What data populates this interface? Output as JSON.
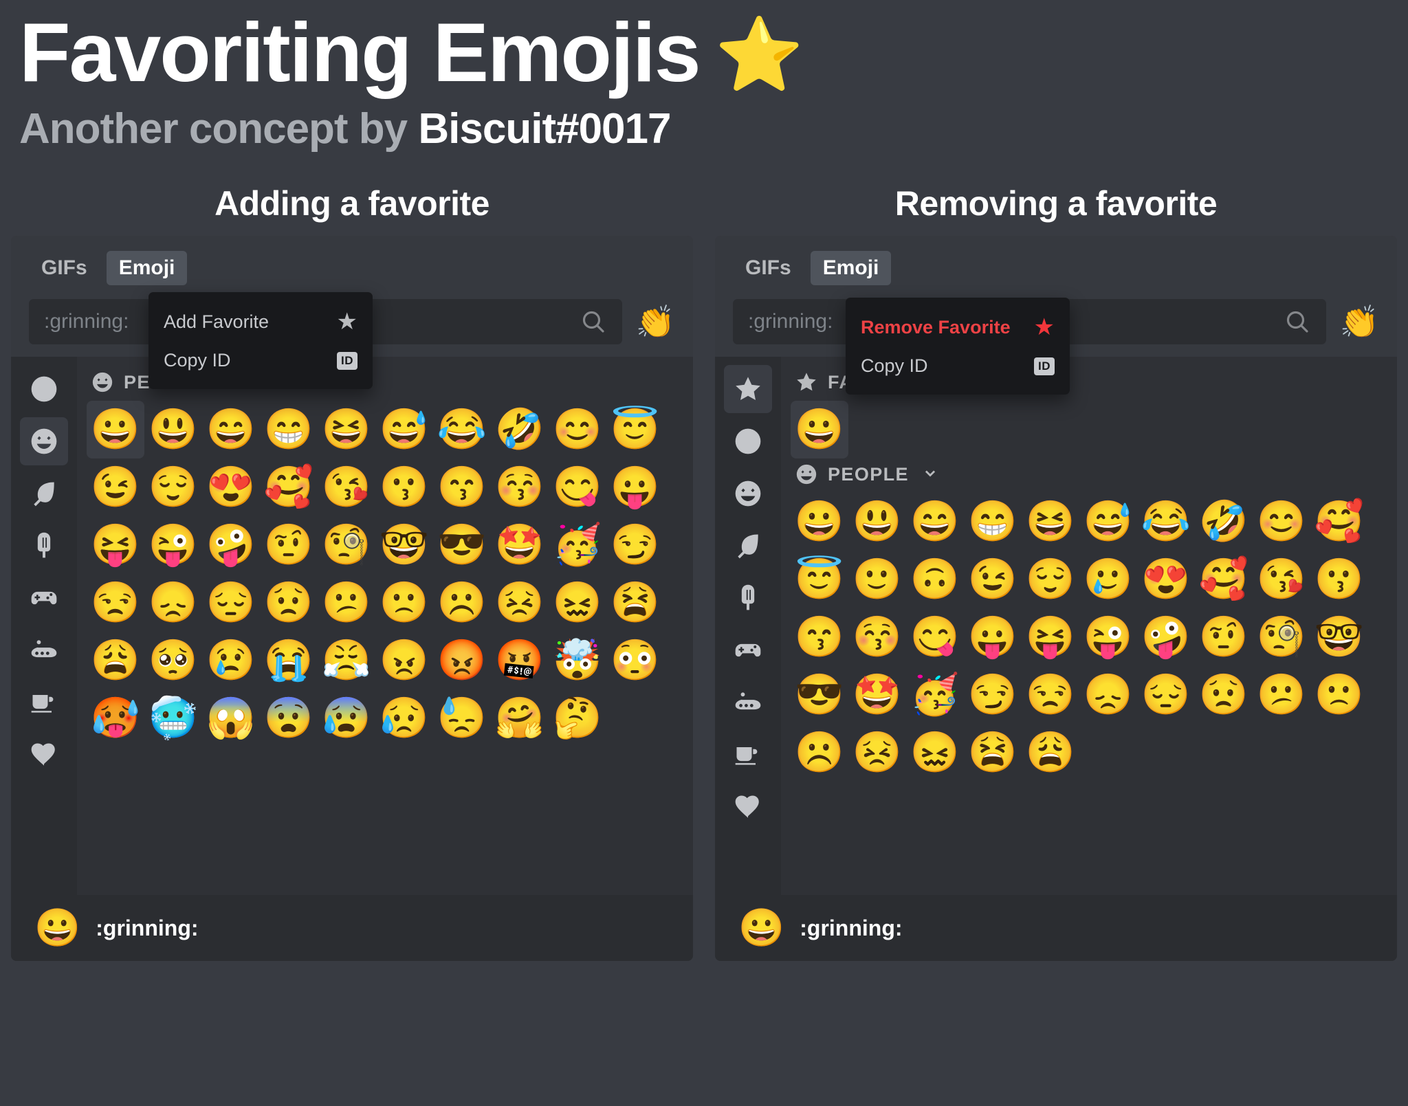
{
  "header": {
    "title": "Favoriting Emojis",
    "title_star": "⭐",
    "subtitle_prefix": "Another concept by ",
    "author": "Biscuit#0017"
  },
  "colors": {
    "page_bg": "#383b42",
    "panel_bg": "#36393f",
    "grid_bg": "#2f3136",
    "sidebar_bg": "#2b2d31",
    "menu_bg": "#18191c",
    "accent_star": "#f5a623",
    "danger": "#ed4245",
    "text_muted": "#b9bbbe",
    "text_white": "#ffffff"
  },
  "columns": [
    {
      "heading": "Adding a favorite",
      "tabs": [
        {
          "label": "GIFs",
          "active": false
        },
        {
          "label": "Emoji",
          "active": true
        }
      ],
      "search": {
        "value": ":grinning:",
        "placeholder": ":grinning:",
        "icon": "search-icon",
        "trailing_emoji": "👏"
      },
      "sidebar": [
        {
          "name": "recent",
          "icon": "clock-icon",
          "active": false
        },
        {
          "name": "people",
          "icon": "smiley-icon",
          "active": true
        },
        {
          "name": "nature",
          "icon": "leaf-icon",
          "active": false
        },
        {
          "name": "food",
          "icon": "popsicle-icon",
          "active": false
        },
        {
          "name": "activities",
          "icon": "gamepad-icon",
          "active": false
        },
        {
          "name": "travel",
          "icon": "vehicle-icon",
          "active": false
        },
        {
          "name": "objects",
          "icon": "mug-icon",
          "active": false
        },
        {
          "name": "symbols",
          "icon": "heart-icon",
          "active": false
        }
      ],
      "category": {
        "icon": "smiley-icon",
        "label": "PEOPLE",
        "chevron": "chevron-down-icon"
      },
      "emoji_rows": [
        [
          "😀",
          "😃",
          "😄",
          "😁",
          "😆",
          "😅",
          "😂",
          "🤣",
          "😊"
        ],
        [
          "😇",
          "😉",
          "😌",
          "😍",
          "🥰",
          "😘",
          "😗",
          "😙",
          "😚"
        ],
        [
          "😋",
          "😛",
          "😝",
          "😜",
          "🤪",
          "🤨",
          "🧐",
          "🤓",
          "😎"
        ],
        [
          "🤩",
          "🥳",
          "😏",
          "😒",
          "😞",
          "😔",
          "😟",
          "😕",
          "🙁"
        ],
        [
          "☹️",
          "😣",
          "😖",
          "😫",
          "😩",
          "🥺",
          "😢",
          "😭",
          "😤"
        ],
        [
          "😠",
          "😡",
          "🤬",
          "🤯",
          "😳",
          "🥵",
          "🥶",
          "😱",
          "😨"
        ],
        [
          "😰",
          "😥",
          "😓",
          "🤗",
          "🤔"
        ]
      ],
      "selected_emoji": "😀",
      "context_menu": {
        "items": [
          {
            "label": "Add Favorite",
            "icon": "star-icon",
            "danger": false
          },
          {
            "label": "Copy ID",
            "icon": "id-badge-icon",
            "danger": false
          }
        ]
      },
      "footer": {
        "emoji": "😀",
        "name": ":grinning:"
      }
    },
    {
      "heading": "Removing a favorite",
      "tabs": [
        {
          "label": "GIFs",
          "active": false
        },
        {
          "label": "Emoji",
          "active": true
        }
      ],
      "search": {
        "value": ":grinning:",
        "placeholder": ":grinning:",
        "icon": "search-icon",
        "trailing_emoji": "👏"
      },
      "sidebar": [
        {
          "name": "favorites",
          "icon": "star-icon",
          "active": true
        },
        {
          "name": "recent",
          "icon": "clock-icon",
          "active": false
        },
        {
          "name": "people",
          "icon": "smiley-icon",
          "active": false
        },
        {
          "name": "nature",
          "icon": "leaf-icon",
          "active": false
        },
        {
          "name": "food",
          "icon": "popsicle-icon",
          "active": false
        },
        {
          "name": "activities",
          "icon": "gamepad-icon",
          "active": false
        },
        {
          "name": "travel",
          "icon": "vehicle-icon",
          "active": false
        },
        {
          "name": "objects",
          "icon": "mug-icon",
          "active": false
        },
        {
          "name": "symbols",
          "icon": "heart-icon",
          "active": false
        }
      ],
      "category": {
        "icon": "star-icon",
        "label": "FAVORITES",
        "chevron": "chevron-down-icon"
      },
      "category_secondary": {
        "icon": "smiley-icon",
        "label": "PEOPLE",
        "chevron": "chevron-down-icon"
      },
      "favorites_row": [
        "😀"
      ],
      "emoji_rows": [
        [
          "😀",
          "😃",
          "😄",
          "😁",
          "😆",
          "😅",
          "😂",
          "🤣",
          "😊"
        ],
        [
          "🥰",
          "😇",
          "🙂",
          "🙃",
          "😉",
          "😌",
          "🥲",
          "😍",
          "🥰"
        ],
        [
          "😘",
          "😗",
          "😙",
          "😚",
          "😋",
          "😛",
          "😝",
          "😜",
          "🤪"
        ],
        [
          "🤨",
          "🧐",
          "🤓",
          "😎",
          "🤩",
          "🥳",
          "😏",
          "😒",
          "😞"
        ],
        [
          "😔",
          "😟",
          "😕",
          "🙁",
          "☹️",
          "😣",
          "😖",
          "😫",
          "😩"
        ]
      ],
      "selected_emoji": "😀",
      "context_menu": {
        "items": [
          {
            "label": "Remove Favorite",
            "icon": "star-icon",
            "danger": true
          },
          {
            "label": "Copy ID",
            "icon": "id-badge-icon",
            "danger": false
          }
        ]
      },
      "footer": {
        "emoji": "😀",
        "name": ":grinning:"
      }
    }
  ]
}
